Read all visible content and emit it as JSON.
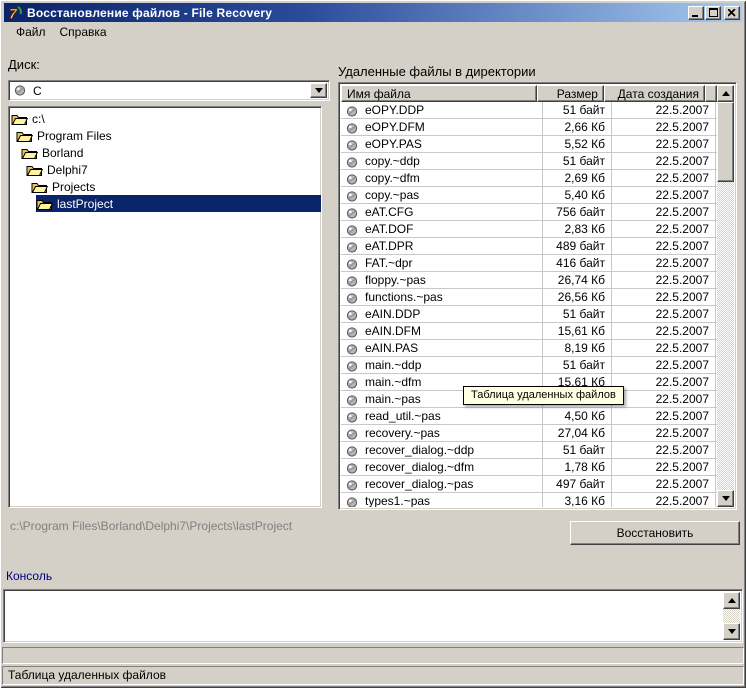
{
  "window": {
    "title": "Восстановление файлов - File Recovery",
    "icon": "delphi7-logo"
  },
  "colors": {
    "titlebar_left": "#0a246a",
    "titlebar_right": "#a6caf0",
    "selection": "#0a246a",
    "tooltip_bg": "#ffffe1",
    "chrome": "#d4d0c8"
  },
  "menu": {
    "items": [
      {
        "label": "Файл"
      },
      {
        "label": "Справка"
      }
    ]
  },
  "left": {
    "disk_label": "Диск:",
    "combo": {
      "value": "C"
    },
    "tree": {
      "items": [
        {
          "label": "c:\\",
          "level": 0,
          "selected": false
        },
        {
          "label": "Program Files",
          "level": 1,
          "selected": false
        },
        {
          "label": "Borland",
          "level": 2,
          "selected": false
        },
        {
          "label": "Delphi7",
          "level": 3,
          "selected": false
        },
        {
          "label": "Projects",
          "level": 4,
          "selected": false
        },
        {
          "label": "lastProject",
          "level": 5,
          "selected": true
        }
      ]
    },
    "path": "c:\\Program Files\\Borland\\Delphi7\\Projects\\lastProject"
  },
  "files": {
    "title": "Удаленные файлы в директории",
    "columns": [
      {
        "label": "Имя файла"
      },
      {
        "label": "Размер"
      },
      {
        "label": "Дата создания"
      }
    ],
    "tooltip": "Таблица удаленных файлов",
    "rows": [
      {
        "name": "eOPY.DDP",
        "size": "51 байт",
        "date": "22.5.2007"
      },
      {
        "name": "eOPY.DFM",
        "size": "2,66 Кб",
        "date": "22.5.2007"
      },
      {
        "name": "eOPY.PAS",
        "size": "5,52 Кб",
        "date": "22.5.2007"
      },
      {
        "name": "copy.~ddp",
        "size": "51 байт",
        "date": "22.5.2007"
      },
      {
        "name": "copy.~dfm",
        "size": "2,69 Кб",
        "date": "22.5.2007"
      },
      {
        "name": "copy.~pas",
        "size": "5,40 Кб",
        "date": "22.5.2007"
      },
      {
        "name": "eAT.CFG",
        "size": "756 байт",
        "date": "22.5.2007"
      },
      {
        "name": "eAT.DOF",
        "size": "2,83 Кб",
        "date": "22.5.2007"
      },
      {
        "name": "eAT.DPR",
        "size": "489 байт",
        "date": "22.5.2007"
      },
      {
        "name": "FAT.~dpr",
        "size": "416 байт",
        "date": "22.5.2007"
      },
      {
        "name": "floppy.~pas",
        "size": "26,74 Кб",
        "date": "22.5.2007"
      },
      {
        "name": "functions.~pas",
        "size": "26,56 Кб",
        "date": "22.5.2007"
      },
      {
        "name": "eAIN.DDP",
        "size": "51 байт",
        "date": "22.5.2007"
      },
      {
        "name": "eAIN.DFM",
        "size": "15,61 Кб",
        "date": "22.5.2007"
      },
      {
        "name": "eAIN.PAS",
        "size": "8,19 Кб",
        "date": "22.5.2007"
      },
      {
        "name": "main.~ddp",
        "size": "51 байт",
        "date": "22.5.2007"
      },
      {
        "name": "main.~dfm",
        "size": "15,61 Кб",
        "date": "22.5.2007"
      },
      {
        "name": "main.~pas",
        "size": "",
        "date": "22.5.2007"
      },
      {
        "name": "read_util.~pas",
        "size": "4,50 Кб",
        "date": "22.5.2007"
      },
      {
        "name": "recovery.~pas",
        "size": "27,04 Кб",
        "date": "22.5.2007"
      },
      {
        "name": "recover_dialog.~ddp",
        "size": "51 байт",
        "date": "22.5.2007"
      },
      {
        "name": "recover_dialog.~dfm",
        "size": "1,78 Кб",
        "date": "22.5.2007"
      },
      {
        "name": "recover_dialog.~pas",
        "size": "497 байт",
        "date": "22.5.2007"
      },
      {
        "name": "types1.~pas",
        "size": "3,16 Кб",
        "date": "22.5.2007"
      }
    ]
  },
  "restore_button_label": "Восстановить",
  "console": {
    "label": "Консоль",
    "content": ""
  },
  "status_bar": {
    "text": "Таблица удаленных файлов"
  }
}
